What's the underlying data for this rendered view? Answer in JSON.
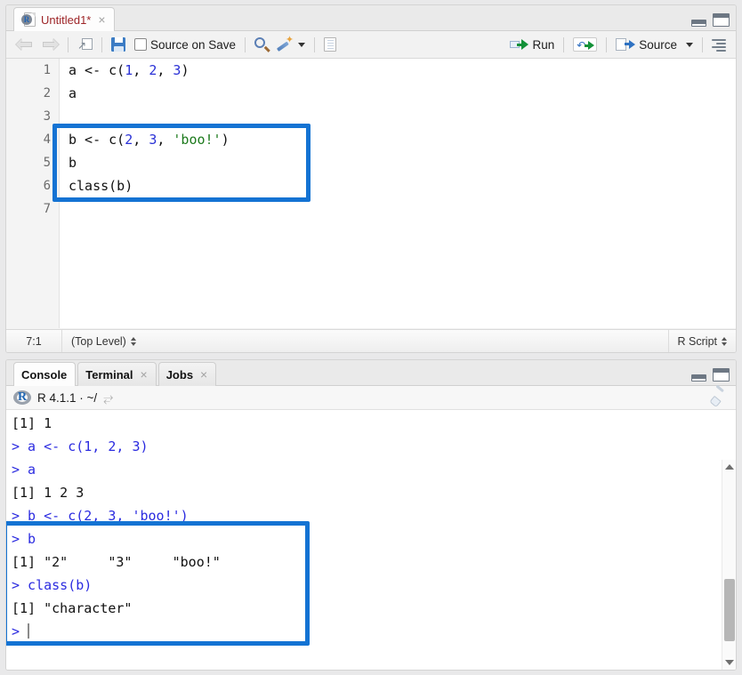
{
  "editor": {
    "tab": {
      "label": "Untitled1*",
      "close": "×",
      "icon": "r-document-icon"
    },
    "toolbar": {
      "back_icon": "back-arrow-icon",
      "forward_icon": "forward-arrow-icon",
      "popout_icon": "show-in-new-window-icon",
      "save_icon": "save-icon",
      "source_on_save_label": "Source on Save",
      "find_icon": "find-replace-icon",
      "wand_icon": "code-tools-icon",
      "compile_report_icon": "compile-report-icon",
      "run_label": "Run",
      "run_icon": "run-icon",
      "rerun_icon": "rerun-previous-icon",
      "source_label": "Source",
      "source_icon": "source-icon",
      "source_menu_icon": "chevron-down-icon",
      "outline_icon": "document-outline-icon"
    },
    "lines": [
      {
        "n": "1",
        "tokens": [
          {
            "t": "a <- c(",
            "c": "plain"
          },
          {
            "t": "1",
            "c": "num"
          },
          {
            "t": ", ",
            "c": "plain"
          },
          {
            "t": "2",
            "c": "num"
          },
          {
            "t": ", ",
            "c": "plain"
          },
          {
            "t": "3",
            "c": "num"
          },
          {
            "t": ")",
            "c": "plain"
          }
        ]
      },
      {
        "n": "2",
        "tokens": [
          {
            "t": "a",
            "c": "plain"
          }
        ]
      },
      {
        "n": "3",
        "tokens": []
      },
      {
        "n": "4",
        "tokens": [
          {
            "t": "b <- c(",
            "c": "plain"
          },
          {
            "t": "2",
            "c": "num"
          },
          {
            "t": ", ",
            "c": "plain"
          },
          {
            "t": "3",
            "c": "num"
          },
          {
            "t": ", ",
            "c": "plain"
          },
          {
            "t": "'boo!'",
            "c": "str"
          },
          {
            "t": ")",
            "c": "plain"
          }
        ]
      },
      {
        "n": "5",
        "tokens": [
          {
            "t": "b",
            "c": "plain"
          }
        ]
      },
      {
        "n": "6",
        "tokens": [
          {
            "t": "class(b)",
            "c": "plain"
          }
        ]
      },
      {
        "n": "7",
        "tokens": []
      }
    ],
    "statusbar": {
      "position": "7:1",
      "scope": "(Top Level)",
      "filetype": "R Script"
    }
  },
  "console": {
    "tabs": [
      {
        "label": "Console",
        "closable": false,
        "active": true
      },
      {
        "label": "Terminal",
        "closable": true,
        "active": false
      },
      {
        "label": "Jobs",
        "closable": true,
        "active": false
      }
    ],
    "close_glyph": "×",
    "header": {
      "r_logo": "r-logo-icon",
      "title": "R 4.1.1  ·  ~/",
      "share_icon": "open-in-window-icon",
      "broom_icon": "clear-console-icon"
    },
    "lines": [
      {
        "tokens": [
          {
            "t": "[1] 1",
            "c": "out"
          }
        ]
      },
      {
        "tokens": [
          {
            "t": "> a <- c(1, 2, 3)",
            "c": "in"
          }
        ]
      },
      {
        "tokens": [
          {
            "t": "> a",
            "c": "in"
          }
        ]
      },
      {
        "tokens": [
          {
            "t": "[1] 1 2 3",
            "c": "out"
          }
        ]
      },
      {
        "tokens": [
          {
            "t": "> b <- c(2, 3, 'boo!')",
            "c": "in"
          }
        ]
      },
      {
        "tokens": [
          {
            "t": "> b",
            "c": "in"
          }
        ]
      },
      {
        "tokens": [
          {
            "t": "[1] \"2\"     \"3\"     \"boo!\"",
            "c": "out"
          }
        ]
      },
      {
        "tokens": [
          {
            "t": "> class(b)",
            "c": "in"
          }
        ]
      },
      {
        "tokens": [
          {
            "t": "[1] \"character\"",
            "c": "out"
          }
        ]
      },
      {
        "tokens": [
          {
            "t": "> ",
            "c": "in"
          }
        ],
        "cursor": true
      }
    ]
  },
  "panes": {
    "minimize_icon": "minimize-pane-icon",
    "maximize_icon": "maximize-pane-icon"
  },
  "annotations": {
    "color": "#1473d3",
    "boxes": [
      {
        "name": "editor-highlight-box",
        "target": "editor lines 4-6"
      },
      {
        "name": "console-highlight-box",
        "target": "console lines b <- c(2,3,'boo!') through [1] \"character\""
      }
    ]
  },
  "scrollbar": {
    "up_icon": "scroll-up-arrow-icon",
    "down_icon": "scroll-down-arrow-icon",
    "thumb": "scrollbar-thumb"
  }
}
